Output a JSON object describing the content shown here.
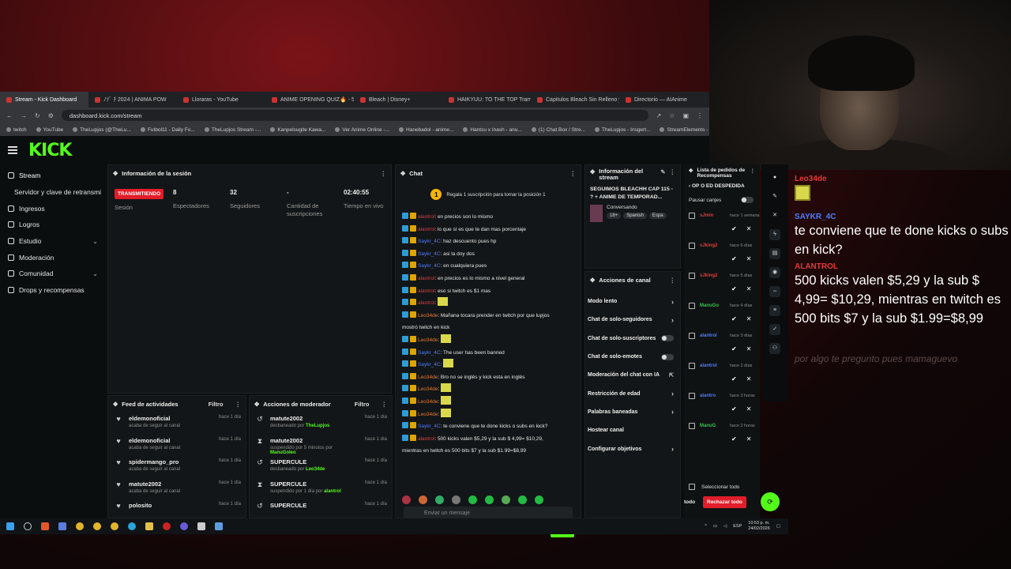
{
  "colors": {
    "brand": "#53fc18",
    "live": "#e21d2a",
    "reject": "#e21d2a"
  },
  "browser": {
    "tabs": [
      "Stream - Kick Dashboard",
      "ﾉﾂﾞ ﾁ 2024 | ANIMA POW",
      "Lloraras - YouTube",
      "ANIME OPENING QUIZ🔥 - 50",
      "Bleach | Disney+",
      "HAIKYUU: TO THE TOP Trampa",
      "Capitulos Bleach Sin Relleno y",
      "Directorio — AIAnime"
    ],
    "url": "dashboard.kick.com/stream",
    "bookmarks": [
      "twitch",
      "YouTube",
      "TheLupjos (@TheLu...",
      "Futbol11 - Daily Fo...",
      "TheLupjos Stream -...",
      "Kanpelsugite Kawa...",
      "Ver Anime Online -...",
      "Hanebadol - anime...",
      "Hantsu x Inash - anu...",
      "(1) Chat Box / Stre...",
      "TheLupjos - Insgert...",
      "StreamElements - O..."
    ]
  },
  "kick": {
    "logo": "KICK"
  },
  "sidebar": {
    "items": [
      {
        "label": "Stream",
        "icon": "broadcast-icon",
        "chev": ""
      },
      {
        "label": "Servidor y clave de retransmi",
        "icon": "",
        "chev": ""
      },
      {
        "label": "Ingresos",
        "icon": "money-icon",
        "chev": ""
      },
      {
        "label": "Logros",
        "icon": "trophy-icon",
        "chev": ""
      },
      {
        "label": "Estudio",
        "icon": "studio-icon",
        "chev": "⌄"
      },
      {
        "label": "Moderación",
        "icon": "wrench-icon",
        "chev": ""
      },
      {
        "label": "Comunidad",
        "icon": "community-icon",
        "chev": "⌄"
      },
      {
        "label": "Drops y recompensas",
        "icon": "gift-icon",
        "chev": ""
      }
    ]
  },
  "session": {
    "title": "Información de la sesión",
    "status": "TRANSMITIENDO",
    "status_label": "Sesión",
    "viewers": "8",
    "viewers_label": "Espectadores",
    "followers": "32",
    "followers_label": "Seguidores",
    "subs": "-",
    "subs_label": "Cantidad de suscripciones",
    "time": "02:40:55",
    "time_label": "Tiempo en vivo"
  },
  "feed": {
    "title": "Feed de actividades",
    "filter": "Filtro",
    "rows": [
      {
        "name": "eldemonoficial",
        "sub": "acaba de seguir al canal",
        "time": "hace 1 día"
      },
      {
        "name": "eldemonoficial",
        "sub": "acaba de seguir al canal",
        "time": "hace 1 día"
      },
      {
        "name": "spidermango_pro",
        "sub": "acaba de seguir al canal",
        "time": "hace 1 día"
      },
      {
        "name": "matute2002",
        "sub": "acaba de seguir al canal",
        "time": "hace 1 día"
      },
      {
        "name": "polosito",
        "sub": "",
        "time": "hace 1 día"
      }
    ]
  },
  "modactions": {
    "title": "Acciones de moderador",
    "filter": "Filtro",
    "rows": [
      {
        "name": "matute2002",
        "sub": "desbaneado por",
        "by": "TheLupjos",
        "time": "hace 1 día"
      },
      {
        "name": "matute2002",
        "sub": "suspendido por 5 minutos por",
        "by": "ManuGoleo",
        "time": "hace 1 día"
      },
      {
        "name": "SUPERCULE",
        "sub": "desbaneado por",
        "by": "Leo34de",
        "time": "hace 1 día"
      },
      {
        "name": "SUPERCULE",
        "sub": "suspendido por 1 día por",
        "by": "alantrol",
        "time": "hace 1 día"
      },
      {
        "name": "SUPERCULE",
        "sub": "",
        "by": "",
        "time": "hace 1 día"
      }
    ]
  },
  "chat": {
    "title": "Chat",
    "pinned_num": "1",
    "pinned": "Regala 1 suscripción para tomar la posición 1",
    "messages": [
      {
        "user": "alantrol",
        "color": "red",
        "text": ": en precios son lo mismo"
      },
      {
        "user": "alantrol",
        "color": "red",
        "text": ": lo que sí es que te dan mas porcentaje"
      },
      {
        "user": "Saykr_4C",
        "color": "blue",
        "text": ": haz descuento pues hp"
      },
      {
        "user": "Saykr_4C",
        "color": "blue",
        "text": ": asi la doy dos"
      },
      {
        "user": "Saykr_4C",
        "color": "blue",
        "text": ": en cualquiera pues"
      },
      {
        "user": "alantrol",
        "color": "red",
        "text": ": en precios es lo mismo a nivel general"
      },
      {
        "user": "alantrol",
        "color": "red",
        "text": ": eso si twitch es $1 mas"
      },
      {
        "user": "alantrol",
        "color": "red",
        "text": ":"
      },
      {
        "user": "Leo34de",
        "color": "org",
        "text": ": Mañana tocara prender en twitch por que lupjos"
      },
      {
        "user": "",
        "color": "",
        "text": "mostró twitch en kick"
      },
      {
        "user": "Leo34de",
        "color": "org",
        "text": ":"
      },
      {
        "user": "Saykr_4C",
        "color": "blue",
        "text": ": The user has been banned"
      },
      {
        "user": "Saykr_4C",
        "color": "blue",
        "text": ":"
      },
      {
        "user": "Leo34de",
        "color": "org",
        "text": ": Bro no se inglés y kick esta en inglés"
      },
      {
        "user": "Leo34de",
        "color": "org",
        "text": ":"
      },
      {
        "user": "Leo34de",
        "color": "org",
        "text": ":"
      },
      {
        "user": "Leo34de",
        "color": "org",
        "text": ":"
      },
      {
        "user": "Saykr_4C",
        "color": "blue",
        "text": ": te conviene que te done kicks o subs en kick?"
      },
      {
        "user": "alantrol",
        "color": "red",
        "text": ": 500 kicks valen $5,29 y la sub $ 4,99= $10,29,"
      },
      {
        "user": "",
        "color": "",
        "text": "mientras en twitch es 500 bits $7 y la sub $1.99=$8,99"
      }
    ],
    "input_placeholder": "Enviar un mensaje",
    "count": "0",
    "send": "Chat"
  },
  "stream_info": {
    "title": "Información del stream",
    "stream_title": "SEGUIMOS BLEACHH CAP 115 - ? + ANIME DE TEMPORAD...",
    "category": "Conversando",
    "tags": [
      "18+",
      "Spanish",
      "Espa"
    ]
  },
  "channel_actions": {
    "title": "Acciones de canal",
    "items": [
      {
        "label": "Modo lento",
        "type": "chev"
      },
      {
        "label": "Chat de solo-seguidores",
        "type": "chev"
      },
      {
        "label": "Chat de solo-suscriptores",
        "type": "toggle"
      },
      {
        "label": "Chat de solo-emotes",
        "type": "toggle"
      },
      {
        "label": "Moderación del chat con IA",
        "type": "ext"
      },
      {
        "label": "Restricción de edad",
        "type": "chev"
      },
      {
        "label": "Palabras baneadas",
        "type": "chev"
      },
      {
        "label": "Hostear canal",
        "type": "none"
      },
      {
        "label": "Configurar objetivos",
        "type": "chev"
      }
    ]
  },
  "rewards": {
    "title": "Lista de pedidos de Recompensas",
    "reward_name": "OP O ED DESPEDIDA",
    "pause": "Pausar canjes",
    "items": [
      {
        "user": "sJmin",
        "time": "hace 1 semana",
        "color": "red"
      },
      {
        "user": "sJking2",
        "time": "hace 6 días",
        "color": "red"
      },
      {
        "user": "sJking2",
        "time": "hace 5 días",
        "color": "red"
      },
      {
        "user": "ManuGo",
        "time": "hace 4 días",
        "color": "green"
      },
      {
        "user": "alantrol",
        "time": "hace 3 días",
        "color": "blue"
      },
      {
        "user": "alantrol",
        "time": "hace 2 días",
        "color": "blue"
      },
      {
        "user": "alantro",
        "time": "hace 3 horas",
        "color": "blue"
      },
      {
        "user": "ManuG",
        "time": "hace 2 horas",
        "color": "green"
      }
    ],
    "select_all": "Seleccionar todo",
    "partial": "todo",
    "reject": "Rechazar todo"
  },
  "overlay": {
    "u1": "Leo34de",
    "u2": "SAYKR_4C",
    "m2": "te conviene que te done kicks o subs en kick?",
    "u3": "ALANTROL",
    "m3": "500 kicks valen $5,29 y la sub $ 4,99= $10,29, mientras en twitch es 500 bits $7 y la sub $1.99=$8,99",
    "faded": "por algo te pregunto pues mamaguevo"
  },
  "taskbar": {
    "time": "10:53 p. m.",
    "date": "24/02/2026",
    "lang": "ESP"
  }
}
